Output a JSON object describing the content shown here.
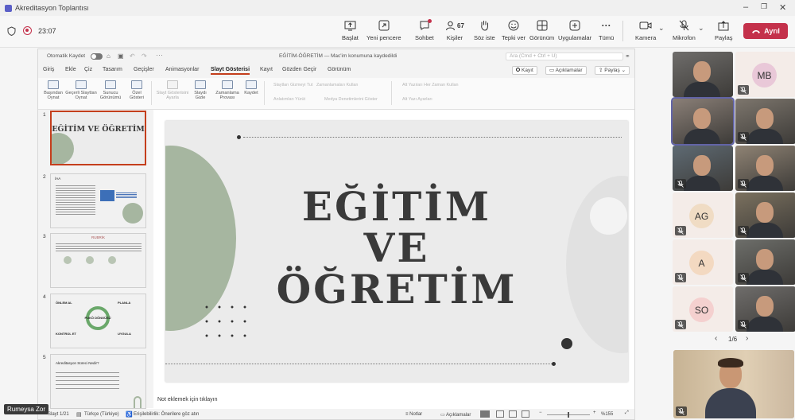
{
  "window": {
    "title": "Akreditasyon Toplantısı"
  },
  "toolbar": {
    "timer": "23:07",
    "buttons": [
      {
        "label": "Başlat",
        "icon": "share-screen-icon"
      },
      {
        "label": "Yeni pencere",
        "icon": "new-window-icon"
      },
      {
        "label": "Sohbet",
        "icon": "chat-icon"
      },
      {
        "label": "Kişiler",
        "icon": "people-icon",
        "count": "67"
      },
      {
        "label": "Söz iste",
        "icon": "raise-hand-icon"
      },
      {
        "label": "Tepki ver",
        "icon": "react-icon"
      },
      {
        "label": "Görünüm",
        "icon": "view-icon"
      },
      {
        "label": "Uygulamalar",
        "icon": "apps-icon"
      },
      {
        "label": "Tümü",
        "icon": "more-icon"
      },
      {
        "label": "Kamera",
        "icon": "camera-icon"
      },
      {
        "label": "Mikrofon",
        "icon": "mic-off-icon"
      },
      {
        "label": "Paylaş",
        "icon": "share-icon"
      }
    ],
    "leave_label": "Ayrıl",
    "leave_color": "#c4314b"
  },
  "ppt": {
    "autosave": "Otomatik Kaydet",
    "doc_title": "EĞİTİM-ÖĞRETİM — Mac'im konumuna kaydedildi",
    "search_placeholder": "Ara (Cmd + Ctrl + U)",
    "menu": [
      "Giriş",
      "Ekle",
      "Çiz",
      "Tasarım",
      "Geçişler",
      "Animasyonlar",
      "Slayt Gösterisi",
      "Kayıt",
      "Gözden Geçir",
      "Görünüm"
    ],
    "active_tab": "Slayt Gösterisi",
    "record_label": "Kayıt",
    "comments_label": "Açıklamalar",
    "share_label": "Paylaş",
    "ribbon": {
      "items": [
        "Başından Oynat",
        "Geçerli Slayttan Oynat",
        "Sunucu Görünümü",
        "Özel Gösteri",
        "Slayt Gösterisini Ayarla",
        "Slaydı Gizle",
        "Zamanlama Provası",
        "Kaydet"
      ],
      "options": [
        "Slaytları Gizmeyi Tut",
        "Zamanlamaları Kullan",
        "Anlatımları Yürüt",
        "Medya Denetimlerini Göster",
        "Alt Yazıları Her Zaman Kullan",
        "Alt Yazı Ayarları"
      ]
    },
    "thumbnails": [
      {
        "num": "1",
        "title": "EĞİTİM VE ÖĞRETİM"
      },
      {
        "num": "2",
        "title": "İAA"
      },
      {
        "num": "3",
        "title": "RUBRİK"
      },
      {
        "num": "4",
        "title": "PUKÖ DÖNGÜSÜ",
        "labels": [
          "ÖNLEM AL",
          "PLANLA",
          "KONTROL ET",
          "UYGULA"
        ]
      },
      {
        "num": "5",
        "title": "Akreditasyon Süreci Nedir?"
      }
    ],
    "slide": {
      "line1": "EĞİTİM",
      "line2": "VE",
      "line3": "ÖĞRETİM"
    },
    "notes_placeholder": "Not eklemek için tıklayın",
    "status": {
      "slide_count": "Slayt 1/21",
      "language": "Türkçe (Türkiye)",
      "accessibility": "Erişilebilirlik: Önerilere göz atın",
      "notes": "Notlar",
      "comments": "Açıklamalar",
      "zoom": "%155"
    }
  },
  "participants": {
    "page": "1/6",
    "tiles": [
      {
        "initials": "",
        "kind": "video"
      },
      {
        "initials": "MB",
        "kind": "avatar",
        "color": "#e9c8d8"
      },
      {
        "initials": "",
        "kind": "video"
      },
      {
        "initials": "",
        "kind": "video"
      },
      {
        "initials": "",
        "kind": "video"
      },
      {
        "initials": "",
        "kind": "video"
      },
      {
        "initials": "AG",
        "kind": "avatar",
        "color": "#f0dcc4"
      },
      {
        "initials": "",
        "kind": "video"
      },
      {
        "initials": "A",
        "kind": "avatar",
        "color": "#f3d9c1"
      },
      {
        "initials": "",
        "kind": "video"
      },
      {
        "initials": "SO",
        "kind": "avatar",
        "color": "#f4d0cf"
      },
      {
        "initials": "",
        "kind": "video"
      }
    ],
    "presenter_name": "Rumeysa Zor"
  }
}
